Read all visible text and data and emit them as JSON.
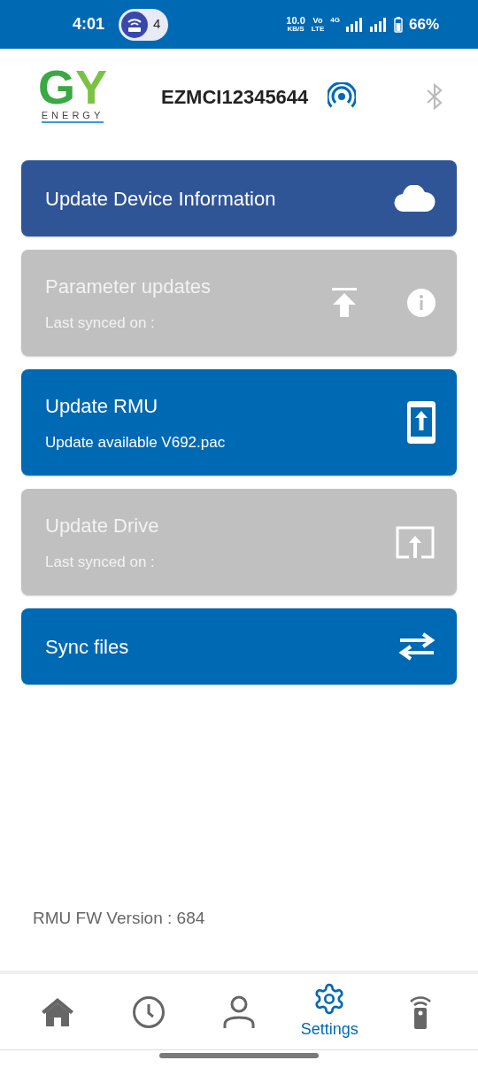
{
  "status_bar": {
    "time": "4:01",
    "hotspot_count": "4",
    "speed": "10.0",
    "speed_unit": "KB/S",
    "volte_top": "Vo",
    "volte_bottom": "LTE",
    "network": "4G",
    "battery": "66%"
  },
  "header": {
    "logo_letters": [
      "G",
      "Y"
    ],
    "logo_tagline": "ENERGY",
    "device_id": "EZMCI12345644",
    "connected": true,
    "bluetooth_on": false
  },
  "cards": [
    {
      "kind": "cloud",
      "title": "Update Device Information",
      "color": "#2f5597",
      "disabled": false,
      "info": false
    },
    {
      "kind": "params",
      "title": "Parameter updates",
      "subtitle": "Last synced on :",
      "color": "#c0c0c0",
      "disabled": true,
      "info": true
    },
    {
      "kind": "rmu",
      "title": "Update RMU",
      "subtitle": "Update available V692.pac",
      "color": "#0069b4",
      "disabled": false,
      "info": false
    },
    {
      "kind": "drive",
      "title": "Update Drive",
      "subtitle": "Last synced on :",
      "color": "#c0c0c0",
      "disabled": true,
      "info": false
    },
    {
      "kind": "sync",
      "title": "Sync files",
      "color": "#0069b4",
      "disabled": false,
      "info": false
    }
  ],
  "footer": {
    "fw_version": "RMU FW Version : 684"
  },
  "nav": [
    {
      "kind": "home",
      "selected": false
    },
    {
      "kind": "history",
      "selected": false
    },
    {
      "kind": "profile",
      "selected": false
    },
    {
      "kind": "settings",
      "label": "Settings",
      "selected": true
    },
    {
      "kind": "remote",
      "selected": false
    }
  ]
}
